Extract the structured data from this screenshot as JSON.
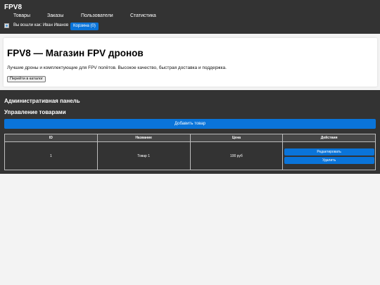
{
  "header": {
    "logo": "FPV8",
    "nav": [
      {
        "label": "Товары"
      },
      {
        "label": "Заказы"
      },
      {
        "label": "Пользователи"
      },
      {
        "label": "Статистика"
      }
    ],
    "user_text": "Вы вошли как: Иван Иванов",
    "cart_label": "Корзина (0)"
  },
  "hero": {
    "title": "FPV8 — Магазин FPV дронов",
    "description": "Лучшие дроны и комплектующие для FPV полётов. Высокое качество, быстрая доставка и поддержка.",
    "button_label": "Перейти в каталог"
  },
  "admin": {
    "title": "Административная панель",
    "section_title": "Управление товарами",
    "add_button_label": "Добавить товар",
    "table": {
      "columns": [
        "ID",
        "Название",
        "Цена",
        "Действия"
      ],
      "rows": [
        {
          "id": "1",
          "name": "Товар 1",
          "price": "100 руб"
        }
      ],
      "edit_label": "Редактировать",
      "delete_label": "Удалить"
    }
  }
}
